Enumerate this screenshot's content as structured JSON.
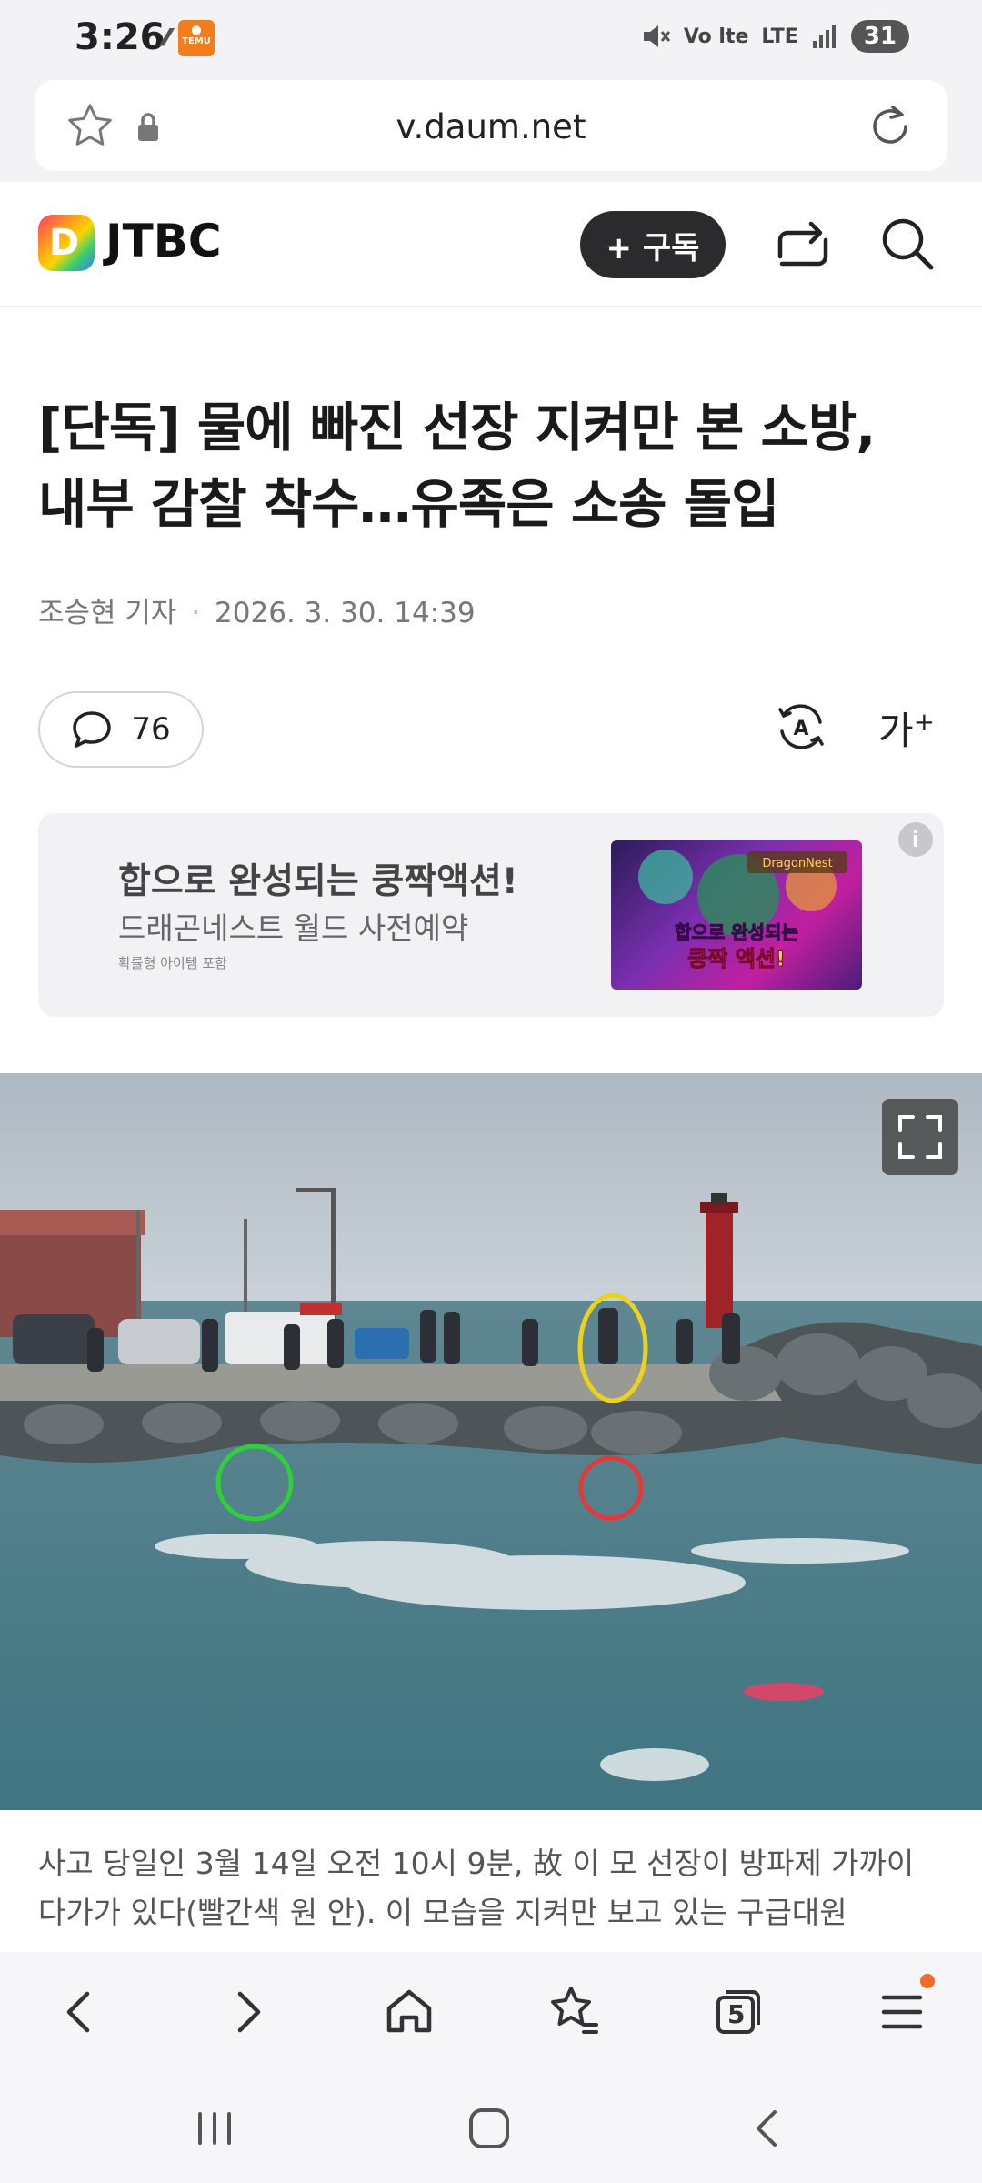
{
  "status_bar": {
    "time": "3:26",
    "signal_text": "Vo lte",
    "lte_text": "LTE",
    "battery": "31"
  },
  "browser": {
    "url": "v.daum.net",
    "tabs_count": "5"
  },
  "header": {
    "logo_letter": "D",
    "channel": "JTBC",
    "subscribe_label": "+ 구독"
  },
  "article": {
    "headline_line1": "[단독] 물에 빠진 선장 지켜만 본 소방,",
    "headline_line2": "내부 감찰 착수…유족은 소송 돌입",
    "author": "조승현 기자",
    "datetime": "2026. 3. 30. 14:39",
    "comment_count": "76",
    "font_size_label": "가",
    "caption_line1": "사고 당일인 3월 14일 오전 10시 9분, 故 이 모 선장이 방파제 가까이",
    "caption_line2": "다가가 있다(빨간색 원 안). 이 모습을 지켜만 보고 있는 구급대원"
  },
  "ad": {
    "title": "합으로 완성되는 쿵짝액션!",
    "subtitle": "드래곤네스트 월드 사전예약",
    "note": "확률형 아이템 포함",
    "image_text_1": "합으로 완성되는",
    "image_text_2": "쿵짝 액션!",
    "image_brand": "DragonNest"
  }
}
